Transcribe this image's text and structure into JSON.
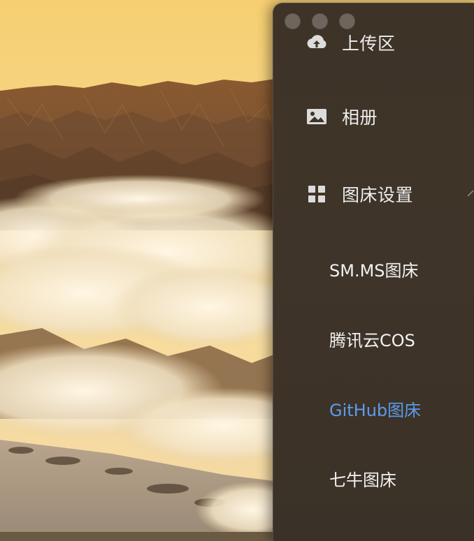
{
  "window": {
    "controls": [
      "close",
      "minimize",
      "zoom"
    ]
  },
  "menu": {
    "items": [
      {
        "label": "上传区",
        "icon": "cloud-upload-icon"
      },
      {
        "label": "相册",
        "icon": "image-icon"
      },
      {
        "label": "图床设置",
        "icon": "grid-icon",
        "expanded": true
      }
    ],
    "sub_items": [
      {
        "label": "SM.MS图床",
        "active": false
      },
      {
        "label": "腾讯云COS",
        "active": false
      },
      {
        "label": "GitHub图床",
        "active": true
      },
      {
        "label": "七牛图床",
        "active": false
      }
    ]
  },
  "colors": {
    "active_item": "#5b9cec",
    "sidebar_bg": "#3d3327",
    "text": "#eeeeee"
  }
}
